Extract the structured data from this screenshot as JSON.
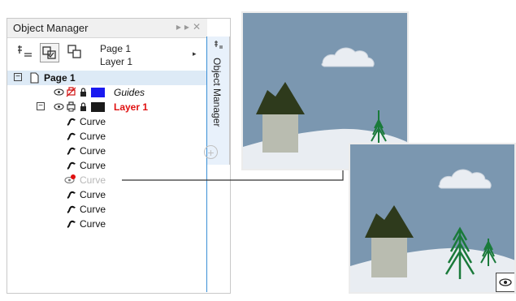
{
  "panel": {
    "title": "Object Manager",
    "tab_label": "Object Manager",
    "page_label": "Page 1",
    "layer_label": "Layer 1"
  },
  "tree": {
    "page": "Page 1",
    "guides": "Guides",
    "layer": "Layer 1",
    "curves": [
      "Curve",
      "Curve",
      "Curve",
      "Curve",
      "Curve",
      "Curve",
      "Curve",
      "Curve"
    ]
  },
  "colors": {
    "guides_swatch": "#1a1af0",
    "layer_swatch": "#1a1a1a",
    "layer_text": "#e01010",
    "sky": "#7b97b0",
    "snow": "#e9edf2",
    "roof": "#2e3a1c",
    "wall": "#b9bcb0",
    "tree": "#1a7a3a",
    "accent": "#3a8fd6"
  },
  "icons": [
    "objects-properties-icon",
    "show-object-properties-icon",
    "edit-across-layers-icon",
    "layer-manager-view-icon",
    "eye-icon",
    "print-icon",
    "lock-icon",
    "curve-icon",
    "hidden-eye-icon",
    "add-icon"
  ]
}
